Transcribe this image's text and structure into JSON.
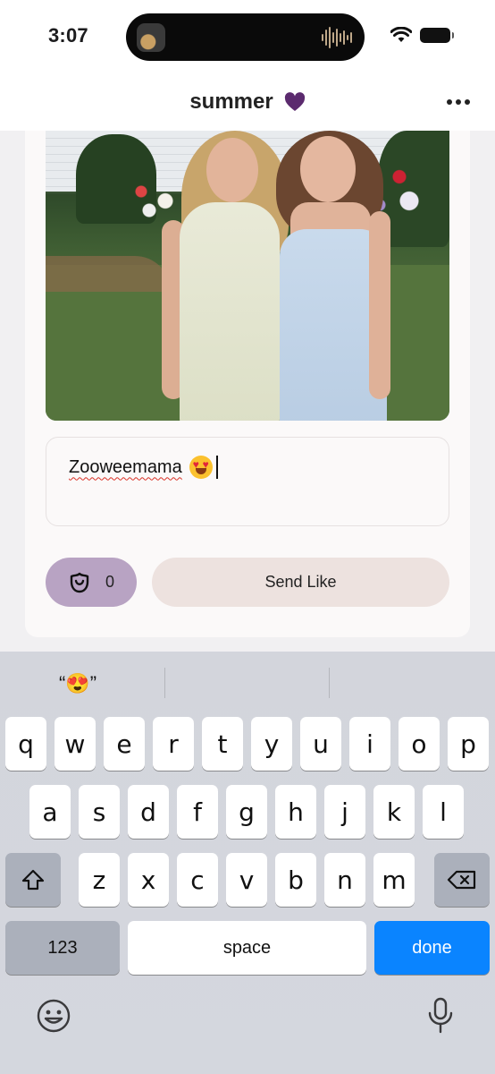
{
  "status_bar": {
    "time": "3:07"
  },
  "header": {
    "title": "summer"
  },
  "composer": {
    "message_text": "Zooweemama",
    "rose_count": "0",
    "send_label": "Send Like"
  },
  "keyboard": {
    "suggestion": "“😍”",
    "row1": [
      "q",
      "w",
      "e",
      "r",
      "t",
      "y",
      "u",
      "i",
      "o",
      "p"
    ],
    "row2": [
      "a",
      "s",
      "d",
      "f",
      "g",
      "h",
      "j",
      "k",
      "l"
    ],
    "row3": [
      "z",
      "x",
      "c",
      "v",
      "b",
      "n",
      "m"
    ],
    "numbers_label": "123",
    "space_label": "space",
    "done_label": "done"
  },
  "colors": {
    "heart": "#5b2a6e",
    "rose_button": "#b8a3c3",
    "send_button": "#ede2df",
    "done_key": "#0a84ff"
  },
  "icons": [
    "wifi-icon",
    "battery-icon",
    "heart-icon",
    "more-icon",
    "rose-icon",
    "shift-icon",
    "backspace-icon",
    "emoji-keyboard-icon",
    "microphone-icon"
  ]
}
